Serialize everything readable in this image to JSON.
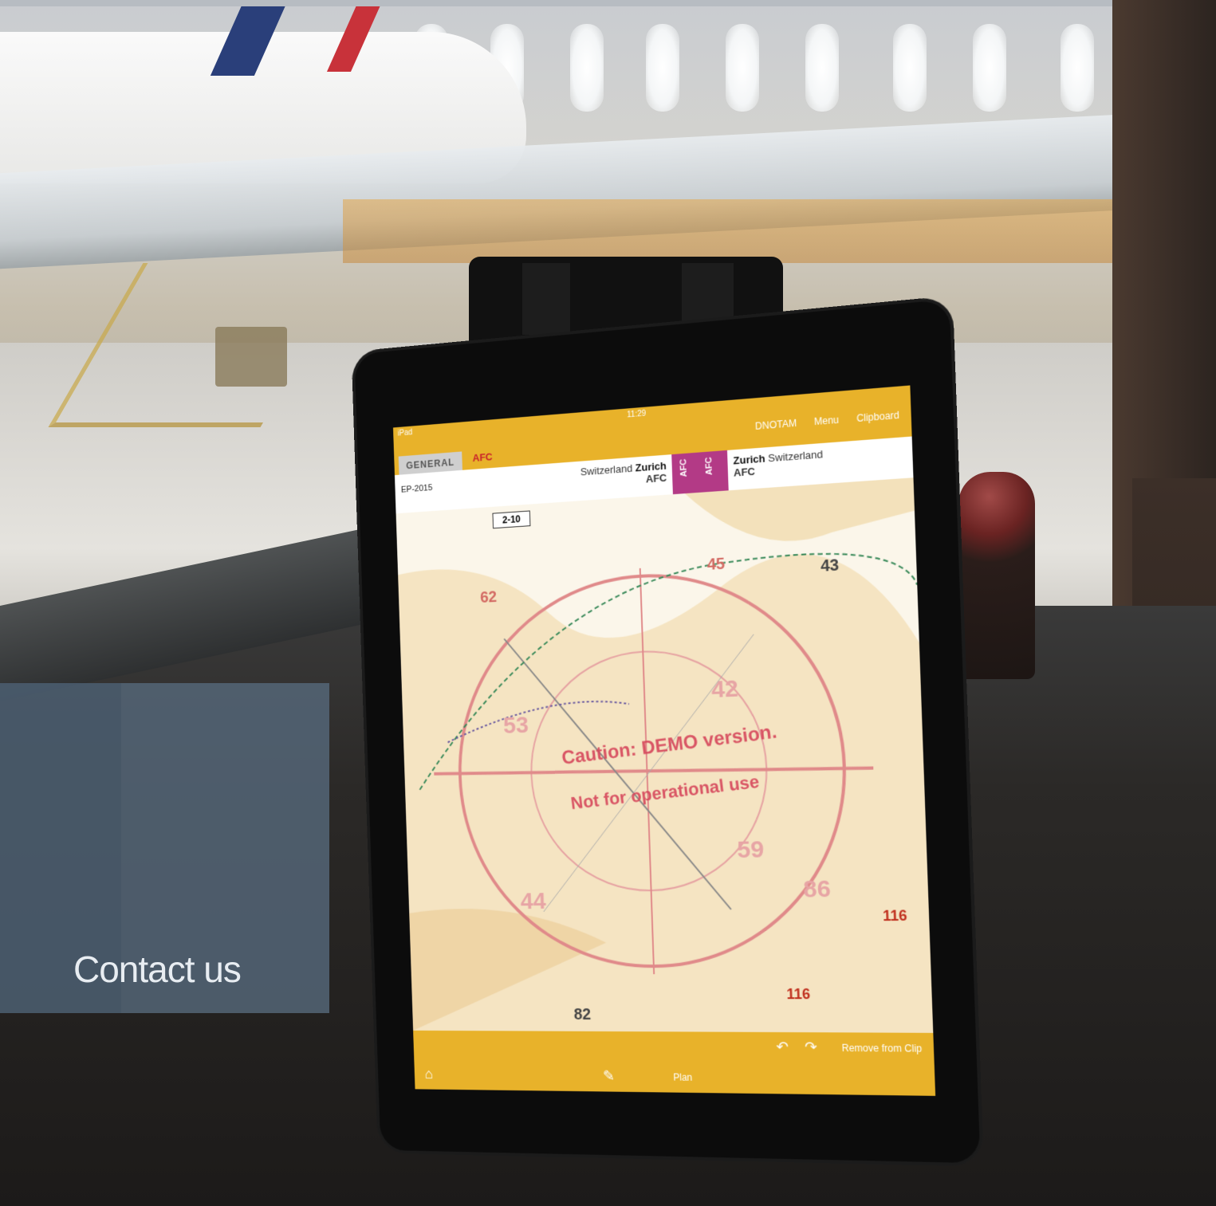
{
  "contact": {
    "label": "Contact us"
  },
  "ipad": {
    "status": {
      "carrier": "iPad",
      "time": "11:29"
    },
    "tabs": [
      "GENERAL",
      "AFC"
    ],
    "top_links": [
      "DNOTAM",
      "Menu",
      "Clipboard"
    ],
    "chart_code": "EP-2015",
    "departure": {
      "country": "Switzerland",
      "city": "Zurich",
      "code": "AFC"
    },
    "arrival": {
      "city": "Zurich",
      "country": "Switzerland",
      "code": "AFC"
    },
    "afc_block": [
      "AFC",
      "AFC"
    ],
    "chart_box": "2-10",
    "caution_text": "Caution: DEMO version.",
    "not_operational_text": "Not for operational use",
    "altitudes": [
      "62",
      "45",
      "43",
      "42",
      "53",
      "59",
      "44",
      "86",
      "116",
      "116",
      "82"
    ],
    "bottom": {
      "remove": "Remove from Clip",
      "plan": "Plan"
    }
  },
  "colors": {
    "panel": "#56687a",
    "app_bar": "#e8b22a",
    "afc_magenta": "#b33a86",
    "caution_red": "#d6475b"
  }
}
